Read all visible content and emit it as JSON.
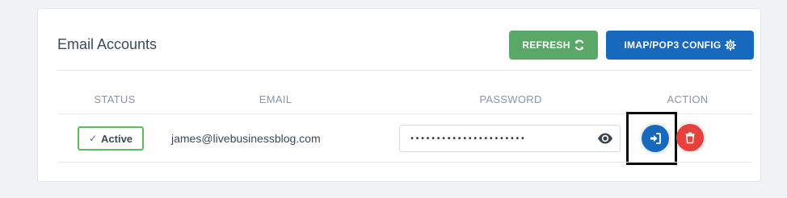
{
  "card": {
    "title": "Email Accounts"
  },
  "toolbar": {
    "refresh_label": "REFRESH",
    "config_label": "IMAP/POP3 CONFIG",
    "refresh_icon": "refresh-icon",
    "config_icon": "gear-icon"
  },
  "table": {
    "columns": [
      "STATUS",
      "EMAIL",
      "PASSWORD",
      "ACTION"
    ],
    "rows": [
      {
        "status": "Active",
        "email": "james@livebusinessblog.com",
        "password": "••••••••••••••••••••••",
        "actions": [
          "login-icon",
          "trash-icon"
        ]
      }
    ]
  },
  "colors": {
    "refresh": "#5aa868",
    "config": "#1669bd",
    "login": "#1669bd",
    "delete": "#e8403c",
    "active_border": "#5fb862"
  }
}
